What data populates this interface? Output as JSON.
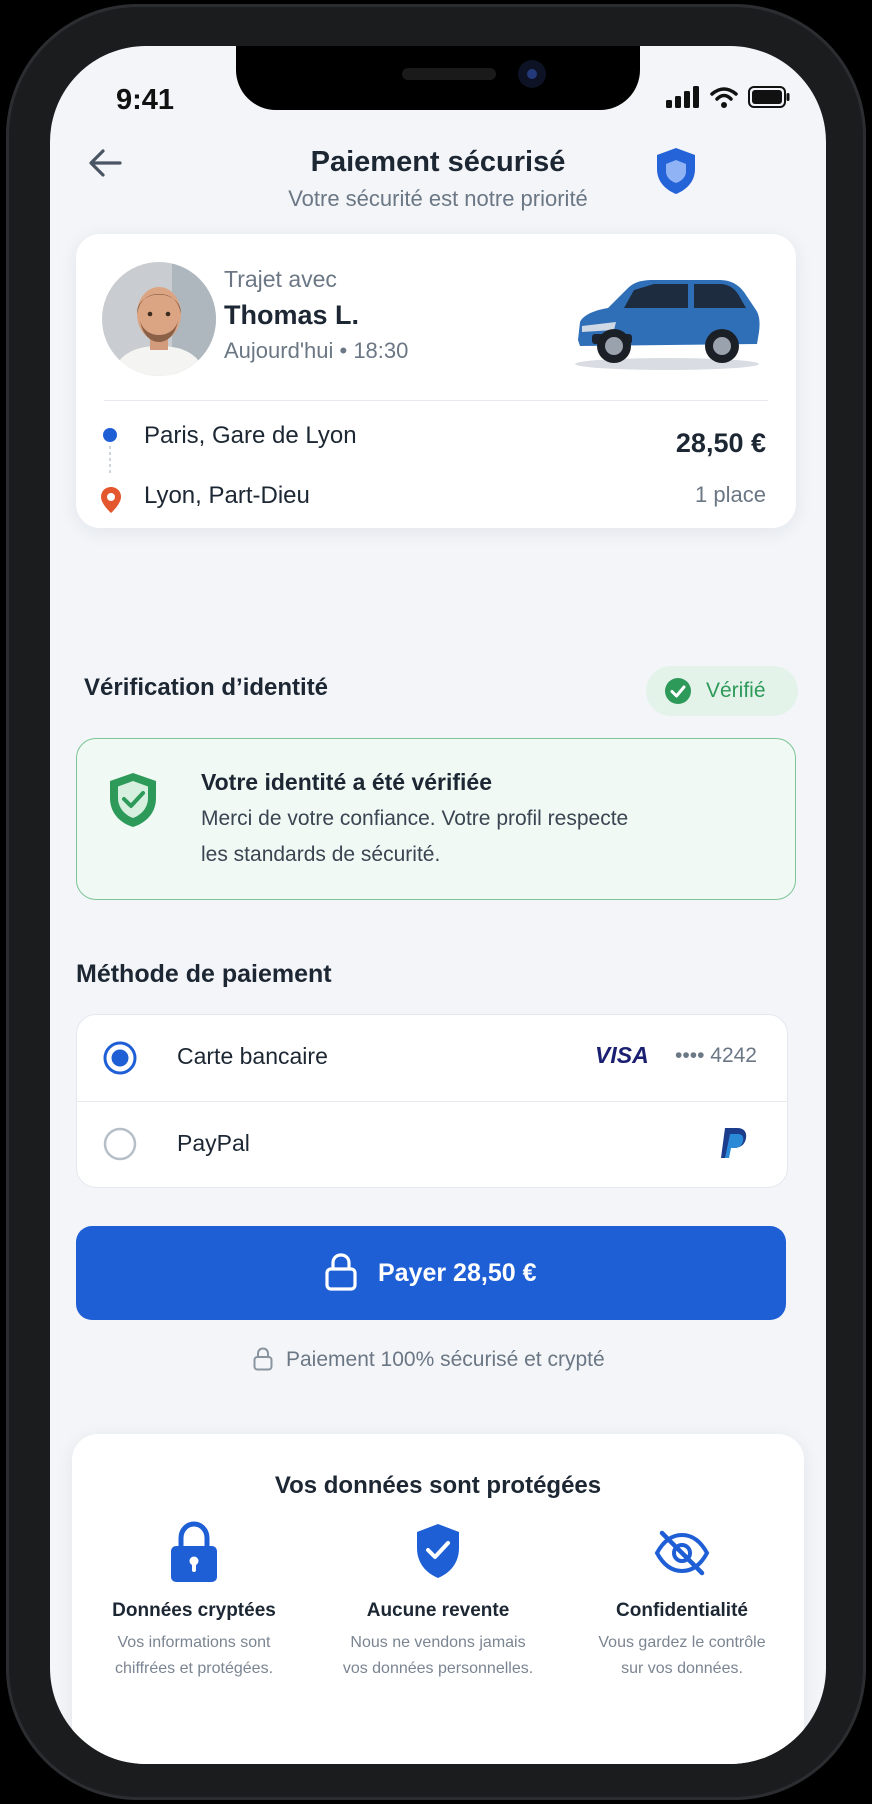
{
  "status_bar": {
    "time": "9:41"
  },
  "header": {
    "title": "Paiement sécurisé",
    "subtitle": "Votre sécurité est notre priorité"
  },
  "trip": {
    "with_label": "Trajet avec",
    "driver_name": "Thomas L.",
    "datetime": "Aujourd'hui • 18:30",
    "from": "Paris, Gare de Lyon",
    "to": "Lyon, Part-Dieu",
    "price": "28,50 €",
    "seats": "1 place"
  },
  "verification": {
    "section_title": "Vérification d’identité",
    "badge": "Vérifié",
    "title": "Votre identité a été vérifiée",
    "line1": "Merci de votre confiance. Votre profil respecte",
    "line2": "les standards de sécurité."
  },
  "payment": {
    "section_title": "Méthode de paiement",
    "methods": [
      {
        "label": "Carte bancaire",
        "brand": "VISA",
        "last4": "•••• 4242",
        "selected": true
      },
      {
        "label": "PayPal",
        "selected": false
      }
    ],
    "pay_button": "Payer 28,50 €",
    "secure_note": "Paiement 100% sécurisé et crypté"
  },
  "protection": {
    "title": "Vos données sont protégées",
    "features": [
      {
        "icon": "padlock-icon",
        "title": "Données cryptées",
        "line1": "Vos informations sont",
        "line2": "chiffrées et protégées."
      },
      {
        "icon": "shield-check-icon",
        "title": "Aucune revente",
        "line1": "Nous ne vendons jamais",
        "line2": "vos données personnelles."
      },
      {
        "icon": "eye-off-icon",
        "title": "Confidentialité",
        "line1": "Vous gardez le contrôle",
        "line2": "sur vos données."
      }
    ]
  },
  "colors": {
    "primary": "#1f5fd6",
    "success": "#2e9a5a",
    "muted": "#6b7785",
    "origin_dot": "#1f5fd6",
    "destination_pin": "#e4572e"
  }
}
